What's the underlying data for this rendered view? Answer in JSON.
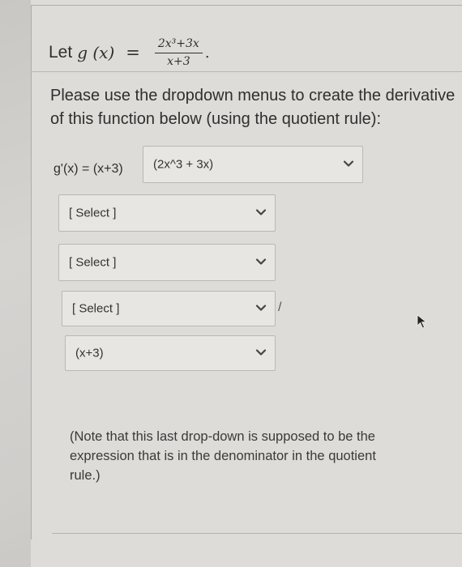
{
  "equation": {
    "prefix": "Let",
    "function": "g (x)",
    "equals": "=",
    "numerator": "2x³+3x",
    "denominator": "x+3",
    "period": "."
  },
  "instructions": {
    "line1": "Please use the dropdown menus to create the derivative",
    "line2": "of this function below (using the quotient rule):"
  },
  "derivative": {
    "label": "g'(x) = (x+3)",
    "numerator_select_value": "(2x^3 + 3x)"
  },
  "selects": [
    {
      "value": "[ Select ]"
    },
    {
      "value": "[ Select ]"
    },
    {
      "value": "[ Select ]"
    },
    {
      "value": "(x+3)"
    }
  ],
  "slash": "/",
  "note": {
    "line1": "(Note that this last drop-down is supposed to be the",
    "line2": "expression that is in the denominator in the quotient",
    "line3": "rule.)"
  },
  "icons": {
    "dropdown": "chevron-down-icon",
    "cursor": "mouse-pointer-icon"
  }
}
